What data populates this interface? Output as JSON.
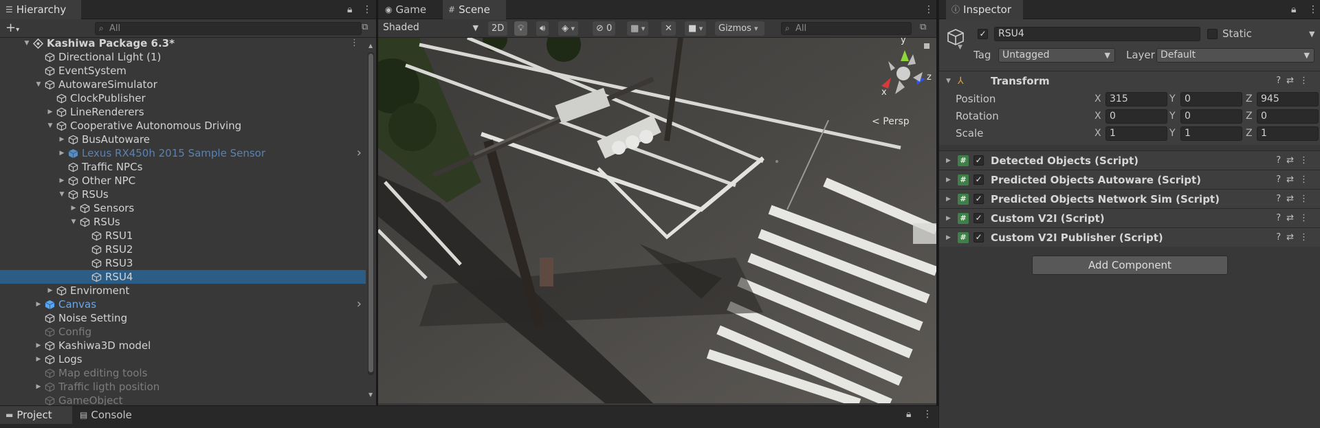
{
  "hierarchy": {
    "tab_label": "Hierarchy",
    "search_placeholder": "All",
    "items": [
      {
        "label": "Kashiwa Package 6.3*",
        "depth": 0,
        "expanded": true,
        "kind": "scene"
      },
      {
        "label": "Directional Light (1)",
        "depth": 1
      },
      {
        "label": "EventSystem",
        "depth": 1
      },
      {
        "label": "AutowareSimulator",
        "depth": 1,
        "expanded": true
      },
      {
        "label": "ClockPublisher",
        "depth": 2
      },
      {
        "label": "LineRenderers",
        "depth": 2,
        "expanded": false
      },
      {
        "label": "Cooperative Autonomous Driving",
        "depth": 2,
        "expanded": true
      },
      {
        "label": "BusAutoware",
        "depth": 3,
        "expanded": false
      },
      {
        "label": "Lexus RX450h 2015 Sample Sensor",
        "depth": 3,
        "expanded": false,
        "kind": "prefab-dim",
        "submenu": true
      },
      {
        "label": "Traffic NPCs",
        "depth": 3
      },
      {
        "label": "Other NPC",
        "depth": 3,
        "expanded": false
      },
      {
        "label": "RSUs",
        "depth": 3,
        "expanded": true
      },
      {
        "label": "Sensors",
        "depth": 4,
        "expanded": false
      },
      {
        "label": "RSUs",
        "depth": 4,
        "expanded": true
      },
      {
        "label": "RSU1",
        "depth": 5
      },
      {
        "label": "RSU2",
        "depth": 5
      },
      {
        "label": "RSU3",
        "depth": 5
      },
      {
        "label": "RSU4",
        "depth": 5,
        "selected": true
      },
      {
        "label": "Enviroment",
        "depth": 2,
        "expanded": false
      },
      {
        "label": "Canvas",
        "depth": 1,
        "expanded": false,
        "kind": "prefab",
        "submenu": true
      },
      {
        "label": "Noise Setting",
        "depth": 1
      },
      {
        "label": "Config",
        "depth": 1,
        "kind": "disabled"
      },
      {
        "label": "Kashiwa3D model",
        "depth": 1,
        "expanded": false
      },
      {
        "label": "Logs",
        "depth": 1,
        "expanded": false
      },
      {
        "label": "Map editing tools",
        "depth": 1,
        "kind": "disabled"
      },
      {
        "label": "Traffic ligth position",
        "depth": 1,
        "expanded": false,
        "kind": "disabled"
      },
      {
        "label": "GameObject",
        "depth": 1,
        "kind": "disabled"
      }
    ]
  },
  "bottom_tabs": {
    "project": "Project",
    "console": "Console"
  },
  "scene_view": {
    "tab_game": "Game",
    "tab_scene": "Scene",
    "shading_mode": "Shaded",
    "mode_2d": "2D",
    "hidden_count": "0",
    "gizmos_label": "Gizmos",
    "search_placeholder": "All",
    "persp_label": "Persp",
    "gizmo_axes": {
      "x": "x",
      "y": "y",
      "z": "z"
    }
  },
  "inspector": {
    "tab_label": "Inspector",
    "object_name": "RSU4",
    "active": true,
    "static_label": "Static",
    "tag_label": "Tag",
    "tag_value": "Untagged",
    "layer_label": "Layer",
    "layer_value": "Default",
    "transform": {
      "title": "Transform",
      "position_label": "Position",
      "rotation_label": "Rotation",
      "scale_label": "Scale",
      "position": {
        "x": "315",
        "y": "0",
        "z": "945"
      },
      "rotation": {
        "x": "0",
        "y": "0",
        "z": "0"
      },
      "scale": {
        "x": "1",
        "y": "1",
        "z": "1"
      }
    },
    "components": [
      {
        "label": "Detected Objects (Script)",
        "enabled": true
      },
      {
        "label": "Predicted Objects Autoware (Script)",
        "enabled": true
      },
      {
        "label": "Predicted Objects Network Sim (Script)",
        "enabled": true
      },
      {
        "label": "Custom V2I (Script)",
        "enabled": true
      },
      {
        "label": "Custom V2I Publisher (Script)",
        "enabled": true
      }
    ],
    "add_component_label": "Add Component"
  },
  "colors": {
    "panel": "#383838",
    "selection": "#2c5d87",
    "prefab_blue": "#6aa6e8",
    "script_green": "#3f7f48"
  }
}
